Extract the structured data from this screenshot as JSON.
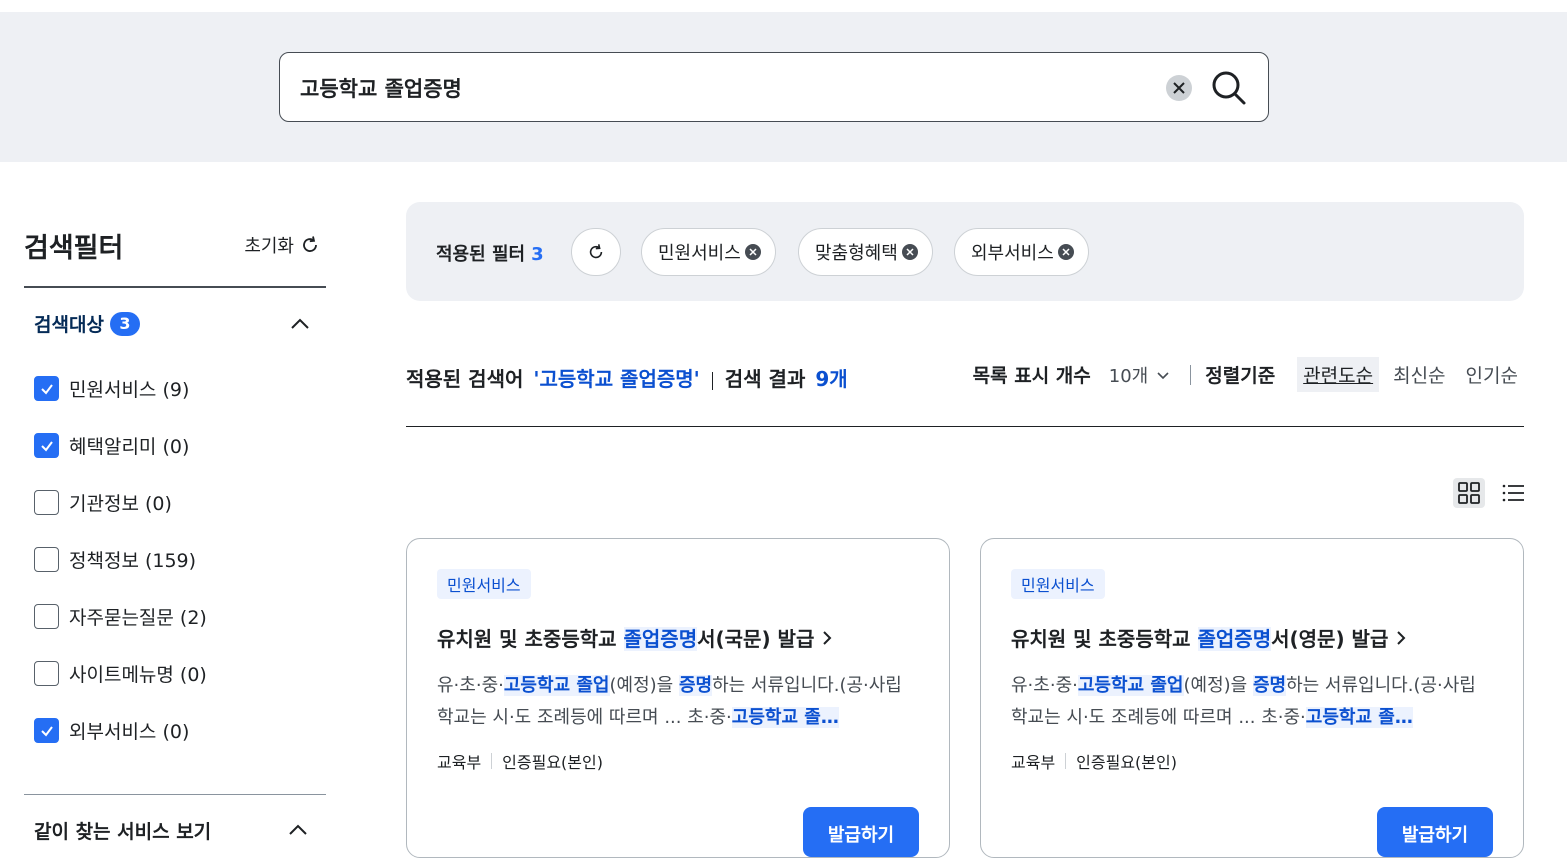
{
  "search": {
    "value": "고등학교 졸업증명",
    "clear_icon": "close-circle-icon",
    "search_icon": "search-icon"
  },
  "sidebar": {
    "title": "검색필터",
    "reset_label": "초기화",
    "section_title": "검색대상",
    "section_count": "3",
    "items": [
      {
        "label": "민원서비스 (9)",
        "checked": true
      },
      {
        "label": "혜택알리미 (0)",
        "checked": true
      },
      {
        "label": "기관정보 (0)",
        "checked": false
      },
      {
        "label": "정책정보 (159)",
        "checked": false
      },
      {
        "label": "자주묻는질문 (2)",
        "checked": false
      },
      {
        "label": "사이트메뉴명 (0)",
        "checked": false
      },
      {
        "label": "외부서비스 (0)",
        "checked": true
      }
    ],
    "section2_title": "같이 찾는 서비스 보기"
  },
  "filters": {
    "label": "적용된 필터",
    "count": "3",
    "chips": [
      "민원서비스",
      "맞춤형혜택",
      "외부서비스"
    ]
  },
  "results": {
    "applied_label": "적용된 검색어",
    "query": "'고등학교 졸업증명'",
    "result_label": "검색 결과",
    "result_count": "9개",
    "perpage_label": "목록 표시 개수",
    "perpage_value": "10개",
    "sort_label": "정렬기준",
    "sort_options": [
      "관련도순",
      "최신순",
      "인기순"
    ],
    "sort_active": "관련도순"
  },
  "cards": [
    {
      "badge": "민원서비스",
      "title_pre": "유치원 및 초중등학교 ",
      "title_hl": "졸업증명",
      "title_post": "서(국문) 발급",
      "desc_1": "유·초·중·",
      "desc_hl1": "고등학교 졸업",
      "desc_2": "(예정)을 ",
      "desc_hl2": "증명",
      "desc_3": "하는 서류입니다.(공·사립학교는 시·도 조례등에 따르며 ... 초·중·",
      "desc_hl3": "고등학교 졸…",
      "org": "교육부",
      "auth": "인증필요(본인)",
      "button": "발급하기"
    },
    {
      "badge": "민원서비스",
      "title_pre": "유치원 및 초중등학교 ",
      "title_hl": "졸업증명",
      "title_post": "서(영문) 발급",
      "desc_1": "유·초·중·",
      "desc_hl1": "고등학교 졸업",
      "desc_2": "(예정)을 ",
      "desc_hl2": "증명",
      "desc_3": "하는 서류입니다.(공·사립학교는 시·도 조례등에 따르며 ... 초·중·",
      "desc_hl3": "고등학교 졸…",
      "org": "교육부",
      "auth": "인증필요(본인)",
      "button": "발급하기"
    }
  ],
  "colors": {
    "primary": "#256ef4",
    "highlight_text": "#0b50d0",
    "band_bg": "#eef0f4"
  }
}
